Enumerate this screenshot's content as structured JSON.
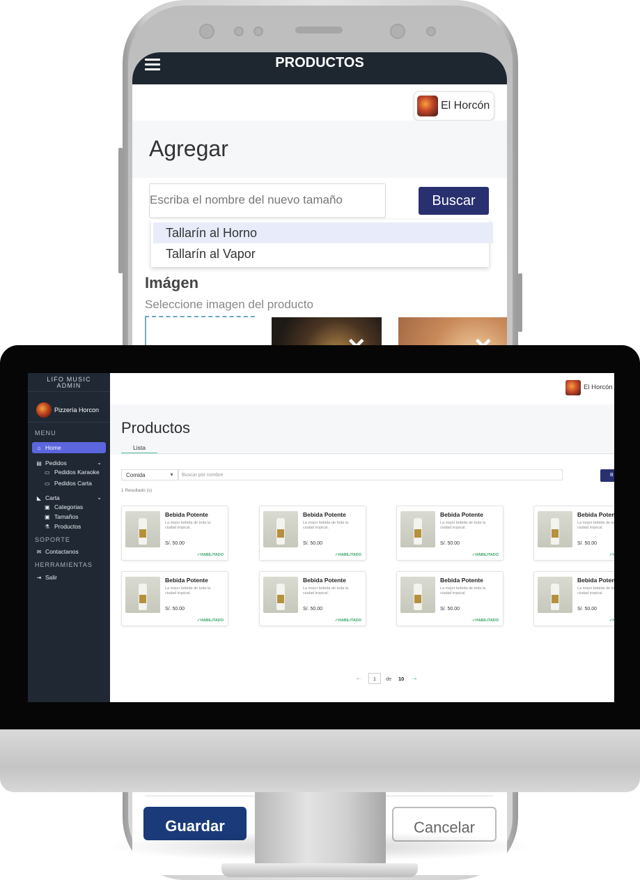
{
  "mobile": {
    "header_title": "PRODUCTOS",
    "brand_name": "El Horcón",
    "heading": "Agregar",
    "search_placeholder": "Escriba el nombre del nuevo tamaño",
    "search_button": "Buscar",
    "suggestions": [
      "Tallarín al Horno",
      "Tallarín al Vapor"
    ],
    "image_section_title": "Imágen",
    "image_section_subtitle": "Seleccione imagen del producto",
    "save_button": "Guardar",
    "cancel_button": "Cancelar"
  },
  "desktop": {
    "sidebar": {
      "app_title_line1": "LIFO MUSIC",
      "app_title_line2": "ADMIN",
      "user_name": "Pizzería Horcon",
      "menu_heading": "MENU",
      "items": {
        "home": "Home",
        "pedidos": "Pedidos",
        "pedidos_karaoke": "Pedidos Karaoke",
        "pedidos_carta": "Pedidos Carta",
        "carta": "Carta",
        "categorias": "Categorias",
        "tamanos": "Tamaños",
        "productos": "Productos",
        "contactanos": "Contactanos",
        "salir": "Salir"
      },
      "soporte_heading": "SOPORTE",
      "herramientas_heading": "HERRAMIENTAS"
    },
    "brand_name": "El Horcón",
    "page_title": "Productos",
    "tab_label": "Lista",
    "filter_select_value": "Comida",
    "search_placeholder": "Buscar por nombre",
    "search_button": "B",
    "result_count": "1 Resultado (s)",
    "product_card": {
      "name": "Bebida Potente",
      "description": "La mejor bebida de toda la ciudad tropical.",
      "price": "S/. 50.00",
      "status": "HABILITADO"
    },
    "pagination": {
      "current_page": "1",
      "of_label": "de",
      "total_pages": "10"
    }
  }
}
